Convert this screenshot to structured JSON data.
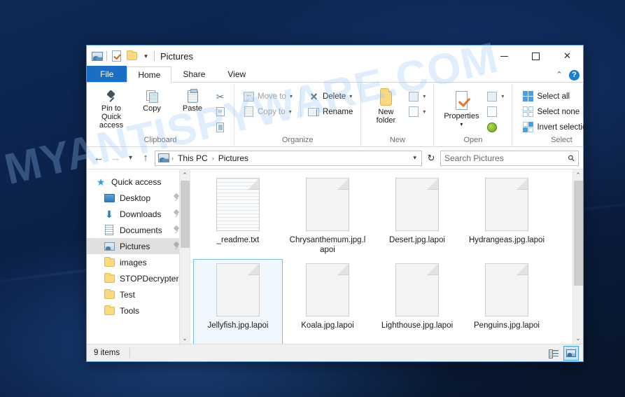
{
  "window": {
    "title": "Pictures",
    "quick_access_toolbar": [
      {
        "name": "pictures-properties-icon",
        "icon": "picture-icon"
      },
      {
        "name": "properties-icon",
        "icon": "properties-checkmark-icon"
      },
      {
        "name": "new-folder-icon",
        "icon": "folder-icon"
      }
    ],
    "qat_dropdown": "▾",
    "controls": {
      "minimize": "minimize-icon",
      "maximize": "maximize-icon",
      "close": "✕"
    }
  },
  "ribbon": {
    "tabs": [
      {
        "label": "File",
        "active": false,
        "kind": "file"
      },
      {
        "label": "Home",
        "active": true,
        "kind": "normal"
      },
      {
        "label": "Share",
        "active": false,
        "kind": "normal"
      },
      {
        "label": "View",
        "active": false,
        "kind": "normal"
      }
    ],
    "collapse_chevron": "⌃",
    "help_label": "?",
    "groups": [
      {
        "title": "Clipboard",
        "big_buttons": [
          {
            "label": "Pin to Quick\naccess",
            "label_line1": "Pin to Quick",
            "label_line2": "access",
            "icon": "pin-icon",
            "disabled": false
          },
          {
            "label": "Copy",
            "icon": "copy-icon",
            "disabled": false
          },
          {
            "label": "Paste",
            "icon": "paste-icon",
            "disabled": false
          }
        ],
        "small_buttons": [
          {
            "label": "",
            "icon": "cut-scissors-icon",
            "disabled": false
          },
          {
            "label": "",
            "icon": "copy-path-icon",
            "disabled": false
          },
          {
            "label": "",
            "icon": "paste-shortcut-icon",
            "disabled": false
          }
        ]
      },
      {
        "title": "Organize",
        "small_buttons": [
          {
            "label": "Move to",
            "icon": "move-to-icon",
            "caret": "▾",
            "disabled": true
          },
          {
            "label": "Copy to",
            "icon": "copy-to-icon",
            "caret": "▾",
            "disabled": true
          },
          {
            "label": "Delete",
            "icon": "delete-icon",
            "caret": "▾",
            "disabled": false
          },
          {
            "label": "Rename",
            "icon": "rename-icon",
            "caret": "",
            "disabled": false
          }
        ]
      },
      {
        "title": "New",
        "big_buttons": [
          {
            "label_line1": "New",
            "label_line2": "folder",
            "icon": "new-folder-icon",
            "disabled": false
          }
        ],
        "small_buttons": [
          {
            "label": "",
            "icon": "new-item-icon",
            "caret": "▾",
            "disabled": true
          },
          {
            "label": "",
            "icon": "easy-access-icon",
            "caret": "▾",
            "disabled": true
          }
        ]
      },
      {
        "title": "Open",
        "big_buttons": [
          {
            "label_line1": "Properties",
            "label_line2": "▾",
            "icon": "properties-icon",
            "disabled": false
          }
        ],
        "small_buttons": [
          {
            "label": "",
            "icon": "open-with-icon",
            "caret": "▾",
            "disabled": true
          },
          {
            "label": "",
            "icon": "edit-icon",
            "caret": "",
            "disabled": true
          },
          {
            "label": "",
            "icon": "history-icon",
            "caret": "",
            "disabled": false
          }
        ]
      },
      {
        "title": "Select",
        "select_items": [
          {
            "label": "Select all",
            "icon": "select-all-icon"
          },
          {
            "label": "Select none",
            "icon": "select-none-icon"
          },
          {
            "label": "Invert selection",
            "icon": "invert-selection-icon"
          }
        ]
      }
    ]
  },
  "navigation": {
    "back": "←",
    "forward": "→",
    "recent": "▾",
    "up": "↑",
    "breadcrumbs": [
      "This PC",
      "Pictures"
    ],
    "breadcrumb_sep": "›",
    "address_caret": "▾",
    "refresh": "↻"
  },
  "search": {
    "placeholder": "Search Pictures",
    "value": "",
    "icon": "search-icon"
  },
  "sidebar": {
    "items": [
      {
        "label": "Quick access",
        "icon": "star-icon",
        "indent": false,
        "pinned": false,
        "selected": false
      },
      {
        "label": "Desktop",
        "icon": "desktop-icon",
        "indent": true,
        "pinned": true,
        "selected": false
      },
      {
        "label": "Downloads",
        "icon": "downloads-icon",
        "indent": true,
        "pinned": true,
        "selected": false
      },
      {
        "label": "Documents",
        "icon": "documents-icon",
        "indent": true,
        "pinned": true,
        "selected": false
      },
      {
        "label": "Pictures",
        "icon": "pictures-icon",
        "indent": true,
        "pinned": true,
        "selected": true
      },
      {
        "label": "images",
        "icon": "folder-icon",
        "indent": true,
        "pinned": false,
        "selected": false
      },
      {
        "label": "STOPDecrypter",
        "icon": "folder-icon",
        "indent": true,
        "pinned": false,
        "selected": false
      },
      {
        "label": "Test",
        "icon": "folder-icon",
        "indent": true,
        "pinned": false,
        "selected": false
      },
      {
        "label": "Tools",
        "icon": "folder-icon",
        "indent": true,
        "pinned": false,
        "selected": false
      }
    ],
    "scroll_up": "⌃",
    "scroll_down": "⌄"
  },
  "files": [
    {
      "name": "_readme.txt",
      "type": "txt",
      "selected": false
    },
    {
      "name": "Chrysanthemum.jpg.lapoi",
      "type": "encrypted",
      "selected": false
    },
    {
      "name": "Desert.jpg.lapoi",
      "type": "encrypted",
      "selected": false
    },
    {
      "name": "Hydrangeas.jpg.lapoi",
      "type": "encrypted",
      "selected": false
    },
    {
      "name": "Jellyfish.jpg.lapoi",
      "type": "encrypted",
      "selected": true
    },
    {
      "name": "Koala.jpg.lapoi",
      "type": "encrypted",
      "selected": false
    },
    {
      "name": "Lighthouse.jpg.lapoi",
      "type": "encrypted",
      "selected": false
    },
    {
      "name": "Penguins.jpg.lapoi",
      "type": "encrypted",
      "selected": false
    }
  ],
  "file_pane": {
    "scroll_up": "⌃",
    "scroll_down": "⌄"
  },
  "statusbar": {
    "item_count": "9 items",
    "view_buttons": [
      {
        "name": "details-view-button",
        "icon": "details-view-icon",
        "active": false
      },
      {
        "name": "large-icons-view-button",
        "icon": "large-icons-view-icon",
        "active": true
      }
    ]
  },
  "watermark": {
    "text": "MYANTISPYWARE.COM"
  },
  "colors": {
    "accent": "#1a6fc4",
    "selection": "#7cc0e8",
    "folder": "#fbd981",
    "desktop": "#0b2149"
  }
}
